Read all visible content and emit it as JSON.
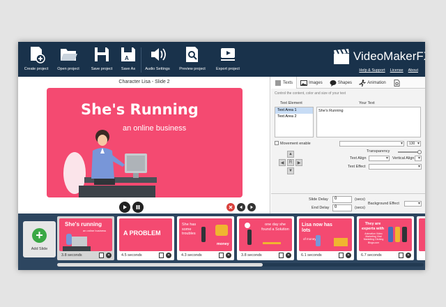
{
  "toolbar": {
    "buttons": [
      {
        "label": "Create project",
        "icon": "create-project-icon"
      },
      {
        "label": "Open project",
        "icon": "folder-icon"
      },
      {
        "label": "Save project",
        "icon": "save-icon"
      },
      {
        "label": "Save As",
        "icon": "save-as-icon"
      },
      {
        "label": "Audio Settings",
        "icon": "speaker-icon"
      },
      {
        "label": "Preview project",
        "icon": "preview-icon"
      },
      {
        "label": "Export project",
        "icon": "export-icon"
      }
    ],
    "brand": "VideoMakerFX",
    "links": [
      "Help & Support",
      "License",
      "About"
    ]
  },
  "stage": {
    "title": "Character Lisa - Slide  2",
    "heading": "She's Running",
    "subheading": "an online business"
  },
  "panel": {
    "tabs": [
      "Texts",
      "Images",
      "Shapes",
      "Animation"
    ],
    "hint": "Control the content, color and size of your text",
    "text_element_header": "Text Element",
    "your_text_header": "Your Text",
    "text_elements": [
      "Text Area 1",
      "Text Area 2"
    ],
    "your_text_value": "She's Running",
    "movement_label": "Movement enable",
    "font_size": "130",
    "transparency_label": "Transparency",
    "text_align_label": "Text Align",
    "vertical_align_label": "Vertical Align",
    "text_effect_label": "Text Effect",
    "dpad_center": "R",
    "slide_delay_label": "Slide Delay",
    "slide_delay_value": "0",
    "end_delay_label": "End Delay",
    "end_delay_value": "0",
    "secs_label": "(secs)",
    "background_effect_label": "Background Effect"
  },
  "timeline": {
    "add_label": "Add Slide",
    "slides": [
      {
        "text": "She's running",
        "sub": "an online business",
        "duration": "3.8 seconds"
      },
      {
        "text": "A PROBLEM",
        "sub": "",
        "duration": "4.5 seconds"
      },
      {
        "text": "She has some troubles",
        "sub": "money",
        "duration": "4.3 seconds"
      },
      {
        "text": "one day she found a Solution",
        "sub": "",
        "duration": "3.8 seconds"
      },
      {
        "text": "Lisa now has lots",
        "sub": "of money",
        "duration": "6.1 seconds"
      },
      {
        "text": "They are experts with",
        "sub": "Animation Video Marketing Viral Marketing Clicking Blogs.com",
        "duration": "6.7 seconds"
      }
    ],
    "scroll_fraction": 0.56
  },
  "colors": {
    "toolbar_bg": "#19324b",
    "slide_pink": "#f44a71",
    "timeline_bg": "#2d4660",
    "add_green": "#3aa845"
  }
}
